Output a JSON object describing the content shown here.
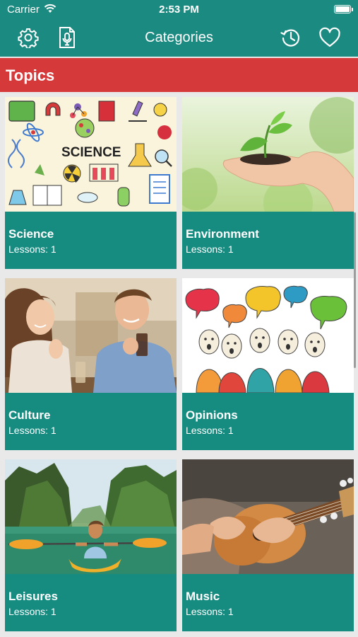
{
  "status": {
    "carrier": "Carrier",
    "time": "2:53 PM"
  },
  "nav": {
    "title": "Categories",
    "icons": [
      "gear-icon",
      "microphone-icon",
      "history-icon",
      "heart-icon"
    ]
  },
  "section": {
    "title": "Topics"
  },
  "topics": [
    {
      "name": "Science",
      "lessons": "Lessons: 1",
      "image_text": "SCIENCE"
    },
    {
      "name": "Environment",
      "lessons": "Lessons: 1"
    },
    {
      "name": "Culture",
      "lessons": "Lessons: 1"
    },
    {
      "name": "Opinions",
      "lessons": "Lessons: 1"
    },
    {
      "name": "Leisures",
      "lessons": "Lessons: 1"
    },
    {
      "name": "Music",
      "lessons": "Lessons: 1"
    }
  ],
  "colors": {
    "navbar": "#1b8a80",
    "section": "#d53939",
    "card_footer": "#168b80"
  }
}
